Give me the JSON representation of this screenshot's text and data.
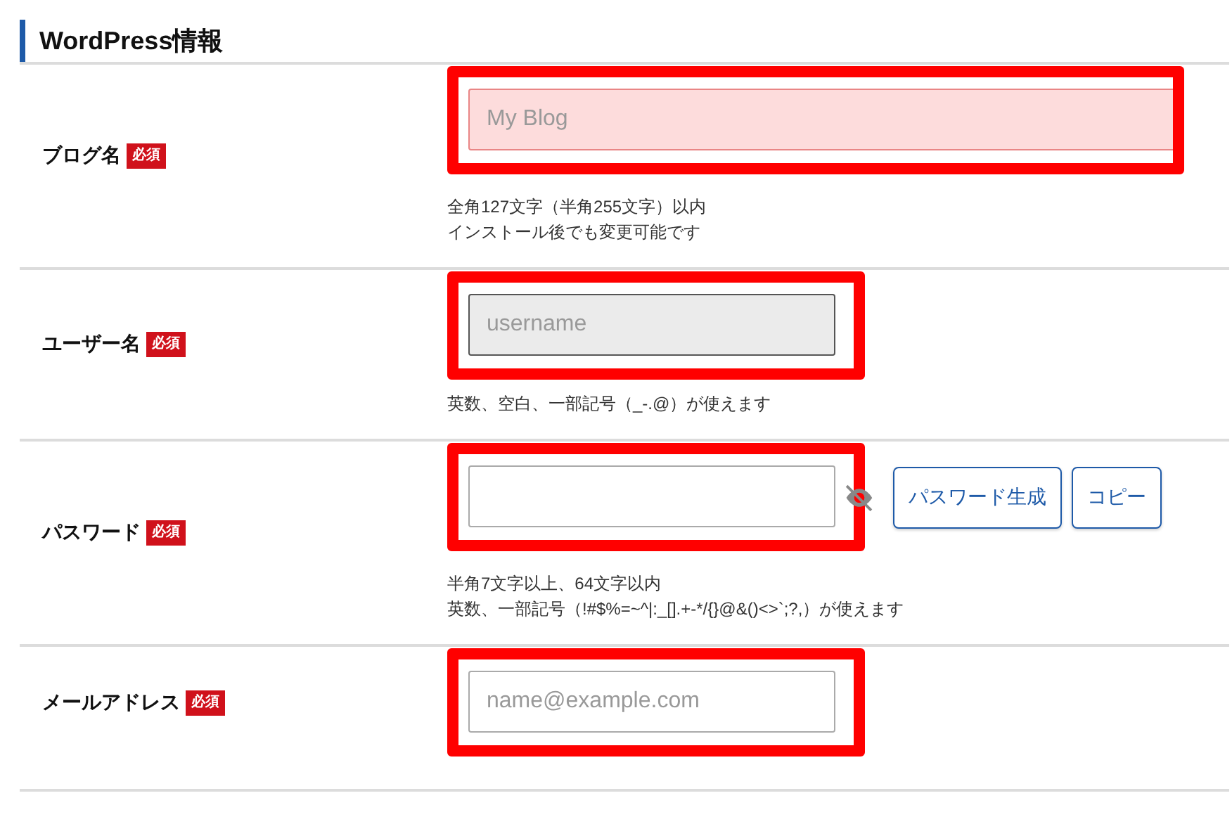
{
  "section": {
    "title": "WordPress情報"
  },
  "rows": [
    {
      "label": "ブログ名",
      "badge": "必須",
      "highlighted": true,
      "wide": true,
      "field": {
        "placeholder": "My Blog",
        "invalid": true,
        "disabled": false
      },
      "hints": [
        "全角127文字（半角255文字）以内",
        "インストール後でも変更可能です"
      ]
    },
    {
      "label": "ユーザー名",
      "badge": "必須",
      "highlighted": true,
      "wide": false,
      "field": {
        "placeholder": "username",
        "invalid": false,
        "disabled": true
      },
      "hints": [
        "英数、空白、一部記号（_-.@）が使えます"
      ]
    },
    {
      "label": "パスワード",
      "badge": "必須",
      "highlighted": true,
      "wide": false,
      "field": {
        "invalid": false,
        "disabled": false
      },
      "reveal_icon": true,
      "buttons": [
        "パスワード生成",
        "コピー"
      ],
      "hints": [
        "半角7文字以上、64文字以内",
        "英数、一部記号（!#$%=~^|:_[].+-*/{}@&()<>`;?,）が使えます"
      ]
    },
    {
      "label": "メールアドレス",
      "badge": "必須",
      "highlighted": true,
      "wide": false,
      "field": {
        "placeholder": "name@example.com",
        "invalid": false,
        "disabled": false
      }
    }
  ]
}
